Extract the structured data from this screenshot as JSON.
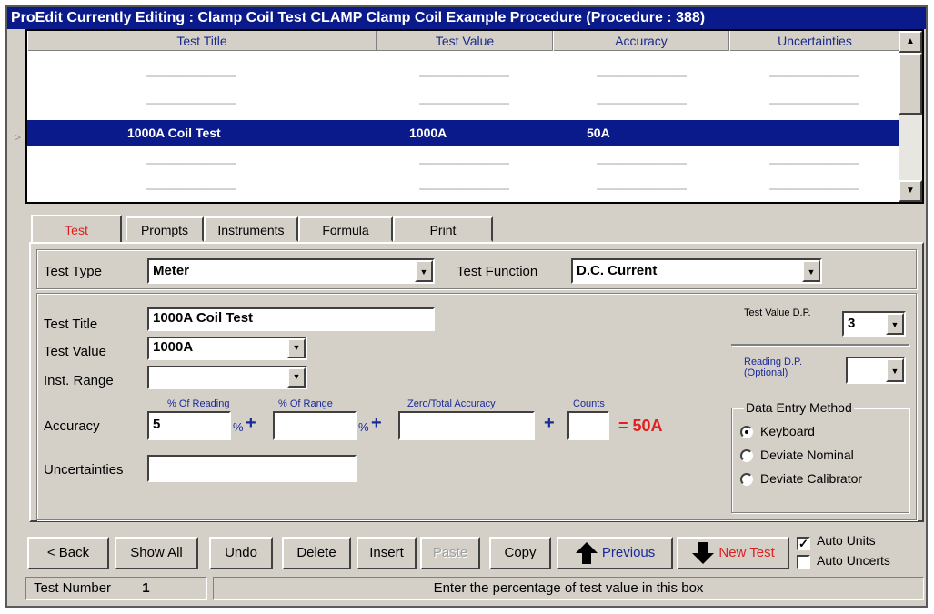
{
  "window": {
    "title": "ProEdit Currently Editing : Clamp Coil Test CLAMP Clamp Coil Example Procedure (Procedure : 388)"
  },
  "grid": {
    "columns": [
      "Test Title",
      "Test Value",
      "Accuracy",
      "Uncertainties"
    ],
    "placeholder": "---------------------------------",
    "selected_row": {
      "title": "1000A Coil Test",
      "value": "1000A",
      "accuracy": "50A",
      "uncertainties": ""
    },
    "row_marker": ">"
  },
  "tabs": [
    "Test",
    "Prompts",
    "Instruments",
    "Formula",
    "Print"
  ],
  "form": {
    "test_type_label": "Test Type",
    "test_type_value": "Meter",
    "test_function_label": "Test Function",
    "test_function_value": "D.C. Current",
    "test_title_label": "Test Title",
    "test_title_value": "1000A Coil Test",
    "test_value_label": "Test Value",
    "test_value_value": "1000A",
    "inst_range_label": "Inst. Range",
    "inst_range_value": "",
    "accuracy_label": "Accuracy",
    "uncertainties_label": "Uncertainties",
    "pct_reading_label": "% Of Reading",
    "pct_range_label": "% Of Range",
    "zero_total_label": "Zero/Total Accuracy",
    "counts_label": "Counts",
    "pct_reading_value": "5",
    "pct_sign": "%",
    "plus": "+",
    "result": "= 50A",
    "test_value_dp_label": "Test Value D.P.",
    "test_value_dp_value": "3",
    "reading_dp_label": "Reading D.P. (Optional)",
    "reading_dp_value": ""
  },
  "data_entry": {
    "title": "Data Entry Method",
    "options": [
      "Keyboard",
      "Deviate Nominal",
      "Deviate Calibrator"
    ],
    "selected": "Keyboard"
  },
  "buttons": {
    "back": "< Back",
    "show_all": "Show All",
    "undo": "Undo",
    "delete": "Delete",
    "insert": "Insert",
    "paste": "Paste",
    "copy": "Copy",
    "previous": "Previous",
    "new_test": "New Test"
  },
  "checkboxes": {
    "auto_units": "Auto Units",
    "auto_units_checked": true,
    "auto_uncerts": "Auto Uncerts",
    "auto_uncerts_checked": false
  },
  "status": {
    "test_number_label": "Test Number",
    "test_number_value": "1",
    "message": "Enter the percentage of test value in this box"
  }
}
